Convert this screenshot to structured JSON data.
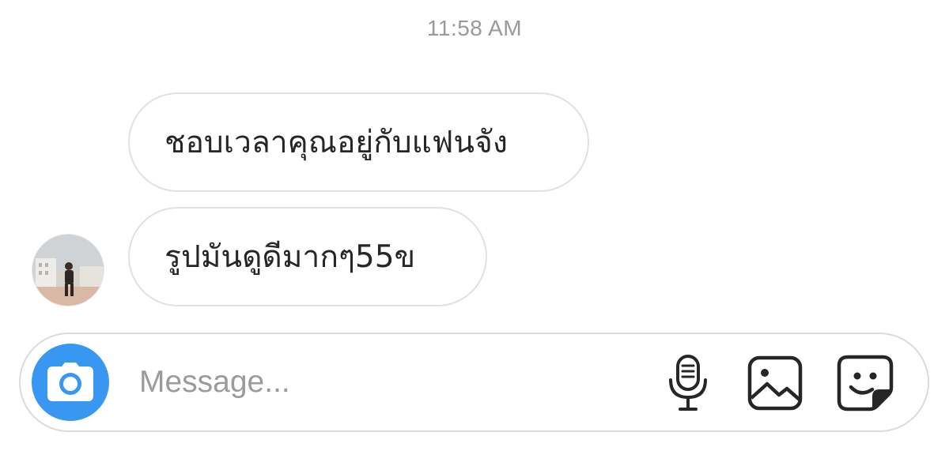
{
  "conversation": {
    "timestamp": "11:58 AM",
    "messages": [
      {
        "sender": "other",
        "text": "ชอบเวลาคุณอยู่กับแฟนจัง"
      },
      {
        "sender": "other",
        "text": "รูปมันดูดีมากๆ55ข"
      }
    ]
  },
  "composer": {
    "placeholder": "Message...",
    "value": "",
    "icons": {
      "camera": "camera-icon",
      "microphone": "microphone-icon",
      "gallery": "gallery-icon",
      "sticker": "sticker-icon"
    },
    "accent_color": "#3897f0"
  },
  "colors": {
    "bubble_border": "#e1e1e1",
    "message_text": "#262626",
    "timestamp_text": "#9a9a9a",
    "placeholder_text": "#9b9b9b"
  }
}
